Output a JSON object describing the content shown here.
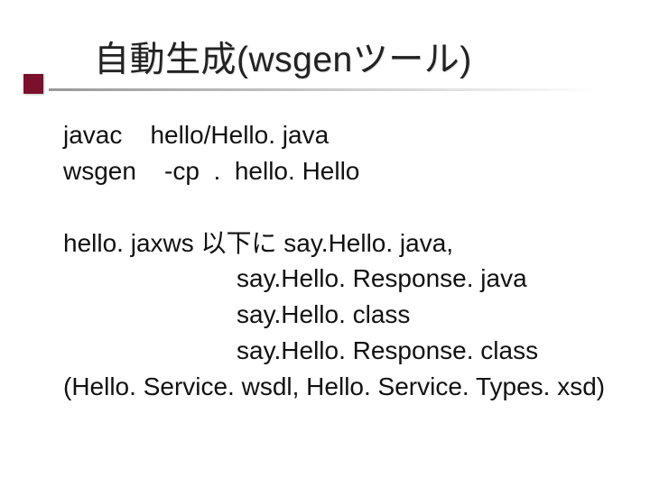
{
  "title": "自動生成(wsgenツール)",
  "lines": {
    "l1": "javac    hello/Hello. java",
    "l2": "wsgen    -cp  .  hello. Hello",
    "l3": "hello. jaxws 以下に say.Hello. java,",
    "l4": "say.Hello. Response. java",
    "l5": "say.Hello. class",
    "l6": "say.Hello. Response. class",
    "l7": "(Hello. Service. wsdl, Hello. Service. Types. xsd)"
  }
}
